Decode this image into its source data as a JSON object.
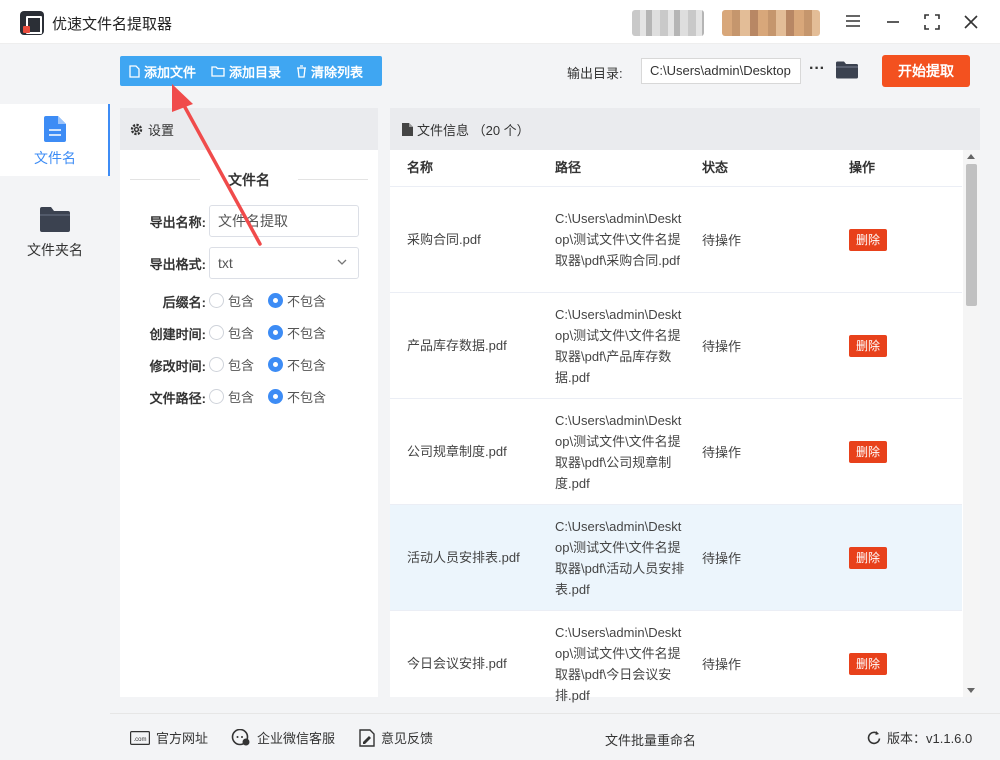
{
  "app": {
    "title": "优速文件名提取器"
  },
  "sidebar": {
    "items": [
      {
        "label": "文件名",
        "icon": "file-icon"
      },
      {
        "label": "文件夹名",
        "icon": "folder-icon"
      }
    ]
  },
  "toolbar": {
    "add_file": "添加文件",
    "add_dir": "添加目录",
    "clear_list": "清除列表",
    "output_label": "输出目录:",
    "output_path": "C:\\Users\\admin\\Desktop",
    "more": "···",
    "start": "开始提取"
  },
  "settings": {
    "header": "设置",
    "section_title": "文件名",
    "export_name_label": "导出名称:",
    "export_name_value": "文件名提取",
    "export_format_label": "导出格式:",
    "export_format_value": "txt",
    "options": [
      {
        "label": "后缀名:",
        "include": "包含",
        "exclude": "不包含",
        "selected": "exclude"
      },
      {
        "label": "创建时间:",
        "include": "包含",
        "exclude": "不包含",
        "selected": "exclude"
      },
      {
        "label": "修改时间:",
        "include": "包含",
        "exclude": "不包含",
        "selected": "exclude"
      },
      {
        "label": "文件路径:",
        "include": "包含",
        "exclude": "不包含",
        "selected": "exclude"
      }
    ]
  },
  "files": {
    "header": "文件信息 （20 个）",
    "columns": [
      "名称",
      "路径",
      "状态",
      "操作"
    ],
    "rows": [
      {
        "name": "采购合同.pdf",
        "path": "C:\\Users\\admin\\Desktop\\测试文件\\文件名提取器\\pdf\\采购合同.pdf",
        "status": "待操作",
        "action": "删除"
      },
      {
        "name": "产品库存数据.pdf",
        "path": "C:\\Users\\admin\\Desktop\\测试文件\\文件名提取器\\pdf\\产品库存数据.pdf",
        "status": "待操作",
        "action": "删除"
      },
      {
        "name": "公司规章制度.pdf",
        "path": "C:\\Users\\admin\\Desktop\\测试文件\\文件名提取器\\pdf\\公司规章制度.pdf",
        "status": "待操作",
        "action": "删除"
      },
      {
        "name": "活动人员安排表.pdf",
        "path": "C:\\Users\\admin\\Desktop\\测试文件\\文件名提取器\\pdf\\活动人员安排表.pdf",
        "status": "待操作",
        "action": "删除"
      },
      {
        "name": "今日会议安排.pdf",
        "path": "C:\\Users\\admin\\Desktop\\测试文件\\文件名提取器\\pdf\\今日会议安排.pdf",
        "status": "待操作",
        "action": "删除"
      }
    ]
  },
  "footer": {
    "website": "官方网址",
    "wechat": "企业微信客服",
    "feedback": "意见反馈",
    "center": "文件批量重命名",
    "version": "版本：v1.1.6.0"
  },
  "colors": {
    "accent": "#3d8cf5",
    "toolbar": "#3fa6f2",
    "start": "#f3511f",
    "delete": "#e8411b"
  }
}
